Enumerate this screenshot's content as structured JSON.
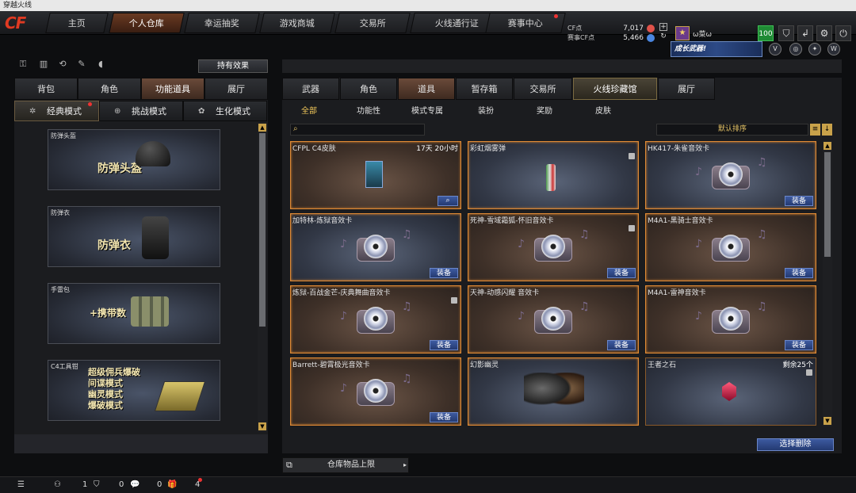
{
  "window": {
    "title": "穿越火线"
  },
  "logo": "CF",
  "nav": {
    "tabs": [
      {
        "label": "主页",
        "active": false
      },
      {
        "label": "个人仓库",
        "active": true
      },
      {
        "label": "幸运抽奖",
        "active": false
      },
      {
        "label": "游戏商城",
        "active": false
      },
      {
        "label": "交易所",
        "active": false
      },
      {
        "label": "火线通行证",
        "active": false
      },
      {
        "label": "赛事中心",
        "active": false
      }
    ]
  },
  "currency": {
    "cf_label": "CF点",
    "cf_value": "7,017",
    "match_label": "赛事CF点",
    "match_value": "5,466"
  },
  "user": {
    "name": "ω菜ω",
    "level": "100"
  },
  "promo": {
    "banner_text": "成长武器!"
  },
  "left": {
    "effect_button": "持有效果",
    "tabs": [
      {
        "label": "背包",
        "active": false
      },
      {
        "label": "角色",
        "active": false
      },
      {
        "label": "功能道具",
        "active": true
      },
      {
        "label": "展厅",
        "active": false
      }
    ],
    "modes": [
      {
        "label": "经典模式",
        "active": true
      },
      {
        "label": "挑战模式",
        "active": false
      },
      {
        "label": "生化模式",
        "active": false
      }
    ],
    "cards": [
      {
        "title": "防弹头盔",
        "text": "防弹头盔"
      },
      {
        "title": "防弹衣",
        "text": "防弹衣"
      },
      {
        "title": "手雷包",
        "text": "+携带数"
      },
      {
        "title": "C4工具钳",
        "lines": [
          "超级佣兵爆破",
          "间谍模式",
          "幽灵模式",
          "爆破模式"
        ]
      }
    ]
  },
  "right": {
    "tabs": [
      {
        "label": "武器",
        "active": false
      },
      {
        "label": "角色",
        "active": false
      },
      {
        "label": "道具",
        "active": true
      },
      {
        "label": "暂存箱",
        "active": false
      },
      {
        "label": "交易所",
        "active": false
      },
      {
        "label": "火线珍藏馆",
        "active": false,
        "special": true
      },
      {
        "label": "展厅",
        "active": false
      }
    ],
    "subtabs": [
      {
        "label": "全部",
        "active": true
      },
      {
        "label": "功能性",
        "active": false
      },
      {
        "label": "模式专属",
        "active": false
      },
      {
        "label": "装扮",
        "active": false
      },
      {
        "label": "奖励",
        "active": false
      },
      {
        "label": "皮肤",
        "active": false
      }
    ],
    "sort_label": "默认排序",
    "equip_label": "装备",
    "items": [
      {
        "name": "CFPL C4皮肤",
        "right_text": "17天 20小时",
        "button": "search",
        "kind": "c4",
        "theme": "brown",
        "selected": true
      },
      {
        "name": "彩虹烟雾弹",
        "right_text": "",
        "button": "",
        "kind": "smoke",
        "theme": "blue",
        "selected": true,
        "lock": true
      },
      {
        "name": "HK417-朱雀音效卡",
        "right_text": "",
        "button": "equip",
        "kind": "disc",
        "theme": "blue",
        "selected": true
      },
      {
        "name": "加特林-炼狱音效卡",
        "right_text": "",
        "button": "equip",
        "kind": "disc",
        "theme": "blue",
        "selected": true
      },
      {
        "name": "死神-雪域霜狐-怀旧音效卡",
        "right_text": "",
        "button": "equip",
        "kind": "disc",
        "theme": "brown",
        "selected": true,
        "lock": true
      },
      {
        "name": "M4A1-黑骑士音效卡",
        "right_text": "",
        "button": "equip",
        "kind": "disc",
        "theme": "brown",
        "selected": true
      },
      {
        "name": "炼狱-百战金芒-庆典舞曲音效卡",
        "right_text": "",
        "button": "equip",
        "kind": "disc",
        "theme": "brown",
        "selected": true,
        "lock": true
      },
      {
        "name": "天神-动感闪耀 音效卡",
        "right_text": "",
        "button": "equip",
        "kind": "disc",
        "theme": "brown",
        "selected": true
      },
      {
        "name": "M4A1-雷神音效卡",
        "right_text": "",
        "button": "equip",
        "kind": "disc",
        "theme": "brown",
        "selected": true
      },
      {
        "name": "Barrett-碧霄极光音效卡",
        "right_text": "",
        "button": "equip",
        "kind": "disc",
        "theme": "brown",
        "selected": true
      },
      {
        "name": "幻影幽灵",
        "right_text": "",
        "button": "",
        "kind": "ghost",
        "theme": "blue",
        "selected": true
      },
      {
        "name": "王者之石",
        "right_text": "剩余25个",
        "button": "",
        "kind": "gem",
        "theme": "blue",
        "selected": false,
        "lock": true
      }
    ],
    "delete_button": "选择删除",
    "capacity_label": "仓库物品上限"
  },
  "bottom": {
    "counts": [
      "1",
      "0",
      "0",
      "4"
    ]
  },
  "colors": {
    "accent": "#e08a34",
    "equip_button": "#2f4a8a",
    "sort_text": "#e4c266"
  },
  "icons": [
    "cf-logo-icon",
    "gift-icon",
    "settings-gear-icon",
    "power-icon",
    "search-icon",
    "sort-arrow-icon",
    "lock-icon",
    "chat-icon",
    "friends-icon",
    "shield-icon"
  ]
}
